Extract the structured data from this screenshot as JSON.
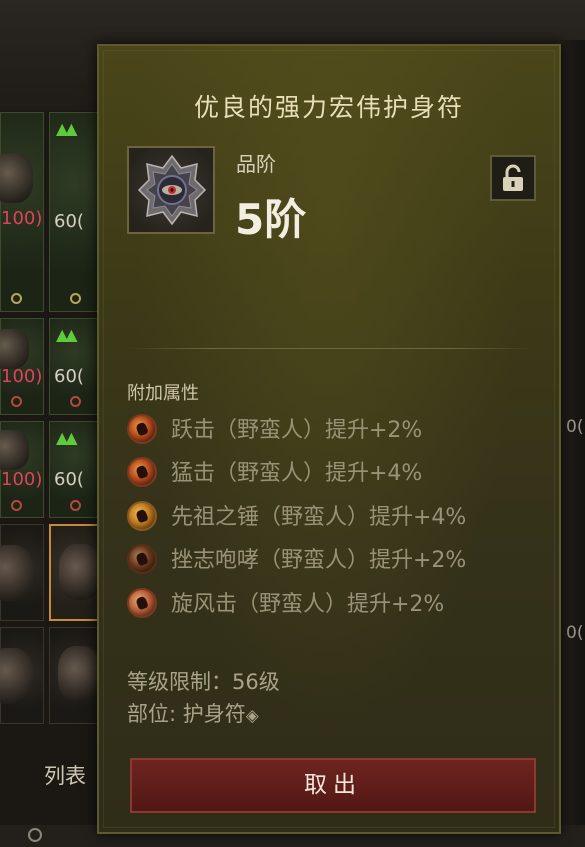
{
  "tooltip": {
    "title": "优良的强力宏伟护身符",
    "grade_label": "品阶",
    "grade_value": "5阶",
    "lock_icon": "unlocked-padlock-icon",
    "section_label": "附加属性",
    "affixes": [
      {
        "text": "跃击（野蛮人）提升+2%",
        "icon": "leap-skill-icon"
      },
      {
        "text": "猛击（野蛮人）提升+4%",
        "icon": "bash-skill-icon"
      },
      {
        "text": "先祖之锤（野蛮人）提升+4%",
        "icon": "hammer-of-ancients-skill-icon"
      },
      {
        "text": "挫志咆哮（野蛮人）提升+2%",
        "icon": "challenging-shout-skill-icon"
      },
      {
        "text": "旋风击（野蛮人）提升+2%",
        "icon": "whirlwind-skill-icon"
      }
    ],
    "level_requirement": "等级限制：56级",
    "slot_type": "部位: 护身符",
    "slot_icon": "amulet-slot-icon",
    "take_out_button": "取出"
  },
  "background": {
    "list_label": "列表",
    "item_level": "60",
    "item_level_paren": "(",
    "durability": "100)",
    "right_edge_value": "0("
  },
  "colors": {
    "tooltip_bg": "#3d3a17",
    "title": "#e8dfba",
    "affix_text": "#9a9276",
    "button_bg": "#6e2420",
    "upgrade_arrow": "#5ecb3c",
    "durability_red": "#e0415c"
  }
}
